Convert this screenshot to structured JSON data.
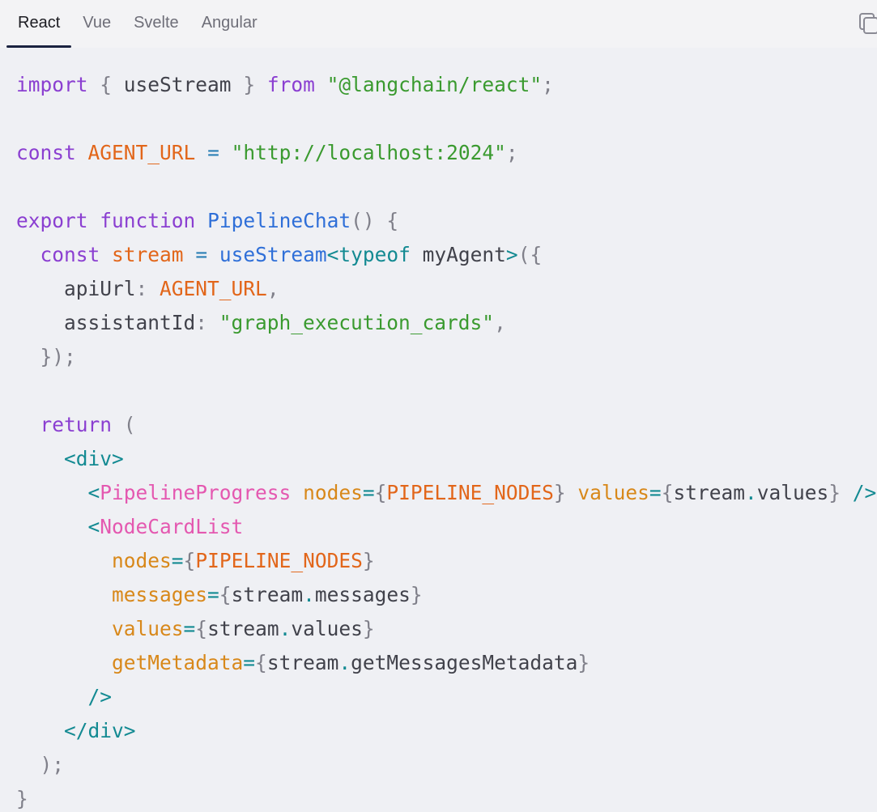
{
  "tabs": [
    {
      "label": "React",
      "active": true
    },
    {
      "label": "Vue",
      "active": false
    },
    {
      "label": "Svelte",
      "active": false
    },
    {
      "label": "Angular",
      "active": false
    }
  ],
  "copy_icon": "copy-icon",
  "colors": {
    "background": "#eff0f4",
    "keyword": "#8b3fd1",
    "string": "#3a9a2f",
    "constant": "#e2661a",
    "function": "#2f6fd8",
    "tag": "#138a92",
    "component": "#e458b0",
    "attribute": "#d8881a"
  },
  "code": {
    "language": "tsx",
    "lines": [
      [
        [
          "k",
          "import"
        ],
        [
          "id",
          " "
        ],
        [
          "p",
          "{"
        ],
        [
          "id",
          " useStream "
        ],
        [
          "p",
          "}"
        ],
        [
          "id",
          " "
        ],
        [
          "k",
          "from"
        ],
        [
          "id",
          " "
        ],
        [
          "s",
          "\"@langchain/react\""
        ],
        [
          "p",
          ";"
        ]
      ],
      [],
      [
        [
          "k",
          "const"
        ],
        [
          "id",
          " "
        ],
        [
          "c",
          "AGENT_URL"
        ],
        [
          "id",
          " "
        ],
        [
          "o",
          "="
        ],
        [
          "id",
          " "
        ],
        [
          "s",
          "\"http://localhost:2024\""
        ],
        [
          "p",
          ";"
        ]
      ],
      [],
      [
        [
          "k",
          "export"
        ],
        [
          "id",
          " "
        ],
        [
          "k",
          "function"
        ],
        [
          "id",
          " "
        ],
        [
          "f",
          "PipelineChat"
        ],
        [
          "p",
          "()"
        ],
        [
          "id",
          " "
        ],
        [
          "p",
          "{"
        ]
      ],
      [
        [
          "id",
          "  "
        ],
        [
          "k",
          "const"
        ],
        [
          "id",
          " "
        ],
        [
          "c",
          "stream"
        ],
        [
          "id",
          " "
        ],
        [
          "o",
          "="
        ],
        [
          "id",
          " "
        ],
        [
          "f",
          "useStream"
        ],
        [
          "t",
          "<"
        ],
        [
          "t",
          "typeof"
        ],
        [
          "id",
          " myAgent"
        ],
        [
          "t",
          ">"
        ],
        [
          "p",
          "({"
        ]
      ],
      [
        [
          "id",
          "    apiUrl"
        ],
        [
          "p",
          ":"
        ],
        [
          "id",
          " "
        ],
        [
          "c",
          "AGENT_URL"
        ],
        [
          "p",
          ","
        ]
      ],
      [
        [
          "id",
          "    assistantId"
        ],
        [
          "p",
          ":"
        ],
        [
          "id",
          " "
        ],
        [
          "s",
          "\"graph_execution_cards\""
        ],
        [
          "p",
          ","
        ]
      ],
      [
        [
          "id",
          "  "
        ],
        [
          "p",
          "});"
        ]
      ],
      [],
      [
        [
          "id",
          "  "
        ],
        [
          "k",
          "return"
        ],
        [
          "id",
          " "
        ],
        [
          "p",
          "("
        ]
      ],
      [
        [
          "id",
          "    "
        ],
        [
          "t",
          "<div>"
        ]
      ],
      [
        [
          "id",
          "      "
        ],
        [
          "t",
          "<"
        ],
        [
          "j",
          "PipelineProgress"
        ],
        [
          "id",
          " "
        ],
        [
          "a",
          "nodes"
        ],
        [
          "t",
          "="
        ],
        [
          "p",
          "{"
        ],
        [
          "c",
          "PIPELINE_NODES"
        ],
        [
          "p",
          "}"
        ],
        [
          "id",
          " "
        ],
        [
          "a",
          "values"
        ],
        [
          "t",
          "="
        ],
        [
          "p",
          "{"
        ],
        [
          "id",
          "stream"
        ],
        [
          "t",
          "."
        ],
        [
          "id",
          "values"
        ],
        [
          "p",
          "}"
        ],
        [
          "id",
          " "
        ],
        [
          "t",
          "/>"
        ]
      ],
      [
        [
          "id",
          "      "
        ],
        [
          "t",
          "<"
        ],
        [
          "j",
          "NodeCardList"
        ]
      ],
      [
        [
          "id",
          "        "
        ],
        [
          "a",
          "nodes"
        ],
        [
          "t",
          "="
        ],
        [
          "p",
          "{"
        ],
        [
          "c",
          "PIPELINE_NODES"
        ],
        [
          "p",
          "}"
        ]
      ],
      [
        [
          "id",
          "        "
        ],
        [
          "a",
          "messages"
        ],
        [
          "t",
          "="
        ],
        [
          "p",
          "{"
        ],
        [
          "id",
          "stream"
        ],
        [
          "t",
          "."
        ],
        [
          "id",
          "messages"
        ],
        [
          "p",
          "}"
        ]
      ],
      [
        [
          "id",
          "        "
        ],
        [
          "a",
          "values"
        ],
        [
          "t",
          "="
        ],
        [
          "p",
          "{"
        ],
        [
          "id",
          "stream"
        ],
        [
          "t",
          "."
        ],
        [
          "id",
          "values"
        ],
        [
          "p",
          "}"
        ]
      ],
      [
        [
          "id",
          "        "
        ],
        [
          "a",
          "getMetadata"
        ],
        [
          "t",
          "="
        ],
        [
          "p",
          "{"
        ],
        [
          "id",
          "stream"
        ],
        [
          "t",
          "."
        ],
        [
          "id",
          "getMessagesMetadata"
        ],
        [
          "p",
          "}"
        ]
      ],
      [
        [
          "id",
          "      "
        ],
        [
          "t",
          "/>"
        ]
      ],
      [
        [
          "id",
          "    "
        ],
        [
          "t",
          "</div>"
        ]
      ],
      [
        [
          "id",
          "  "
        ],
        [
          "p",
          ");"
        ]
      ],
      [
        [
          "p",
          "}"
        ]
      ]
    ]
  }
}
